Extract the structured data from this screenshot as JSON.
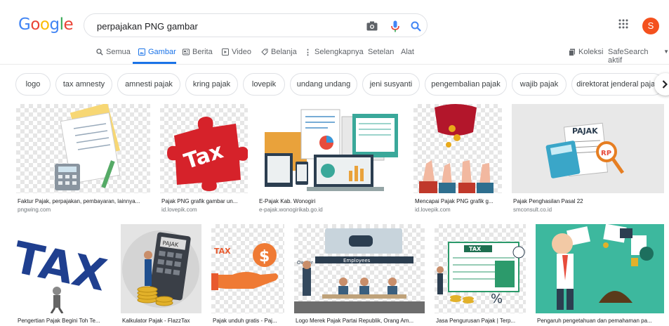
{
  "header": {
    "logo_letters": [
      {
        "ch": "G",
        "color": "#4285F4"
      },
      {
        "ch": "o",
        "color": "#EA4335"
      },
      {
        "ch": "o",
        "color": "#FBBC05"
      },
      {
        "ch": "g",
        "color": "#4285F4"
      },
      {
        "ch": "l",
        "color": "#34A853"
      },
      {
        "ch": "e",
        "color": "#EA4335"
      }
    ],
    "search_value": "perpajakan PNG gambar",
    "avatar_letter": "S",
    "avatar_color": "#f4511e",
    "icons": [
      "camera-icon",
      "microphone-icon",
      "search-icon",
      "apps-grid-icon"
    ]
  },
  "tabs": {
    "semua": "Semua",
    "gambar": "Gambar",
    "berita": "Berita",
    "video": "Video",
    "belanja": "Belanja",
    "selengkapnya": "Selengkapnya",
    "setelan": "Setelan",
    "alat": "Alat",
    "koleksi": "Koleksi",
    "safesearch": "SafeSearch aktif"
  },
  "chips": [
    "logo",
    "tax amnesty",
    "amnesti pajak",
    "kring pajak",
    "lovepik",
    "undang undang",
    "jeni susyanti",
    "pengembalian pajak",
    "wajib pajak",
    "direktorat jenderal pajak"
  ],
  "results_row1": [
    {
      "caption": "Faktur Pajak, perpajakan, pembayaran, lainnya...",
      "domain": "pngwing.com"
    },
    {
      "caption": "Pajak PNG grafik gambar un...",
      "domain": "id.lovepik.com",
      "art_text": "Tax"
    },
    {
      "caption": "E-Pajak Kab. Wonogiri",
      "domain": "e-pajak.wonogirikab.go.id"
    },
    {
      "caption": "Mencapai Pajak PNG grafik g...",
      "domain": "id.lovepik.com"
    },
    {
      "caption": "Pajak Penghasilan Pasal 22",
      "domain": "smconsult.co.id",
      "art_text": "PAJAK",
      "art_text2": "RP"
    }
  ],
  "results_row2": [
    {
      "caption": "Pengertian Pajak Begini Toh Te...",
      "art_text": "TAX"
    },
    {
      "caption": "Kalkulator Pajak - FlazzTax",
      "art_text": "PAJAK"
    },
    {
      "caption": "Pajak unduh gratis - Paj...",
      "art_text": "TAX"
    },
    {
      "caption": "Logo Merek Pajak Partai Republik, Orang Am...",
      "art_text": "Employees",
      "art_text2": "Owner"
    },
    {
      "caption": "Jasa Pengurusan Pajak | Terp...",
      "art_text": "TAX"
    },
    {
      "caption": "Pengaruh pengetahuan dan pemahaman pa..."
    }
  ]
}
